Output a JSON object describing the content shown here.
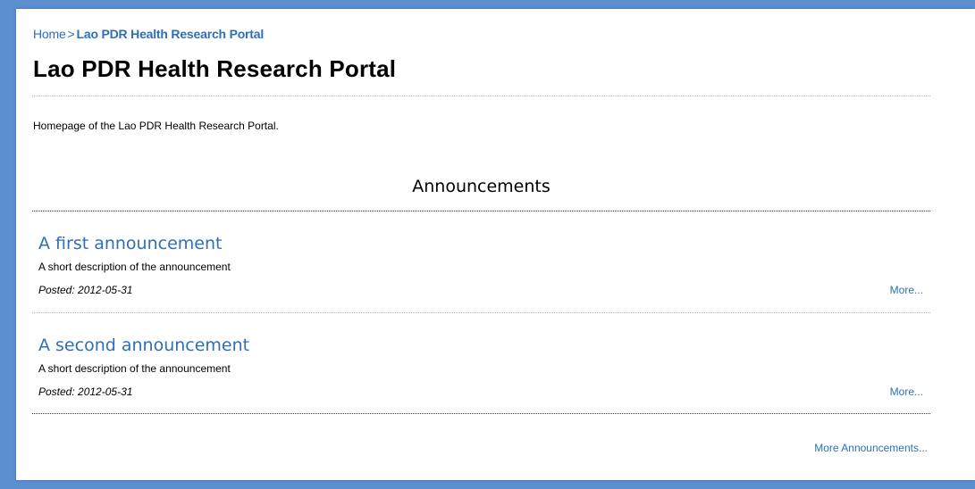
{
  "breadcrumb": {
    "home": "Home",
    "separator": ">",
    "current": "Lao PDR Health Research Portal"
  },
  "page": {
    "title": "Lao PDR Health Research Portal",
    "description": "Homepage of the Lao PDR Health Research Portal."
  },
  "announcements": {
    "heading": "Announcements",
    "items": [
      {
        "title": "A first announcement",
        "description": "A short description of the announcement",
        "posted": "Posted: 2012-05-31",
        "more": "More..."
      },
      {
        "title": "A second announcement",
        "description": "A short description of the announcement",
        "posted": "Posted: 2012-05-31",
        "more": "More..."
      }
    ],
    "more_link": "More Announcements..."
  },
  "colors": {
    "frame": "#5b8fd0",
    "link": "#2f6fb6"
  }
}
